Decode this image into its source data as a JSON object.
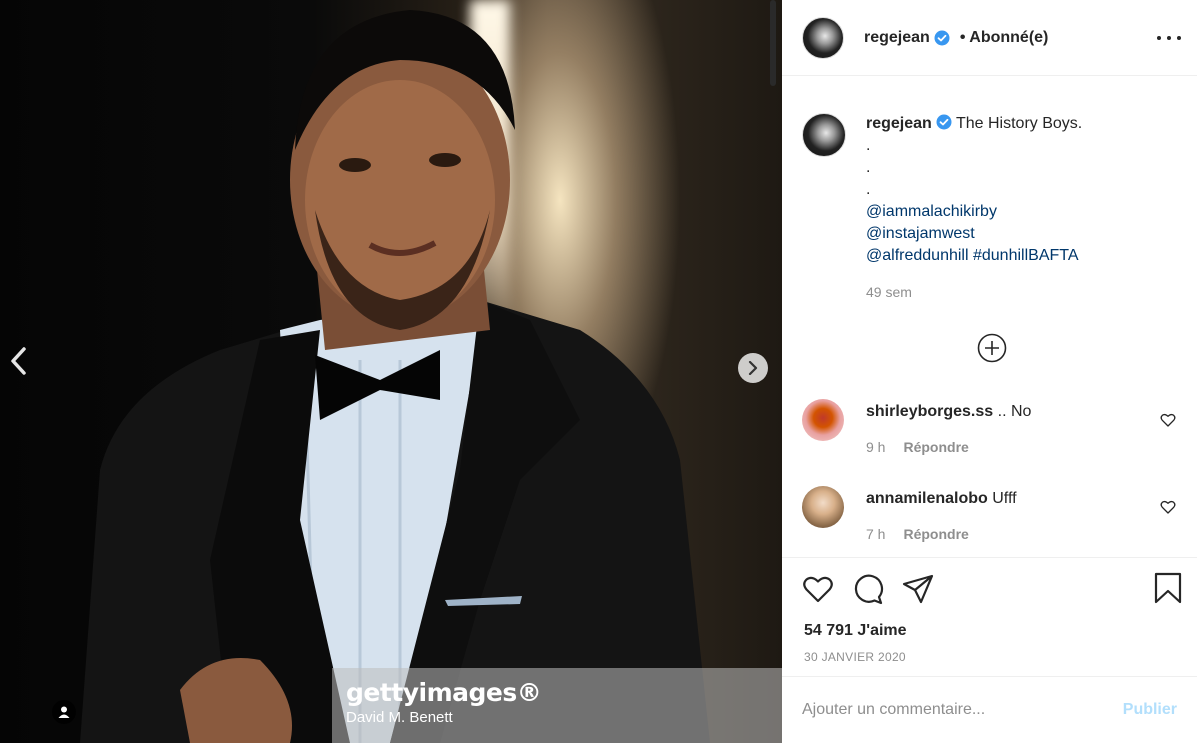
{
  "post": {
    "author": "regejean",
    "follow_status": "• Abonné(e)",
    "more_icon": "more-horizontal-icon",
    "verified_icon": "verified-badge-icon"
  },
  "media": {
    "watermark_brand": "gettyimages®",
    "watermark_credit": "David M. Benett",
    "prev_icon": "chevron-left-icon",
    "next_icon": "chevron-right-icon",
    "tag_icon": "user-tag-icon"
  },
  "caption": {
    "username": "regejean",
    "text": "The History Boys.",
    "dots": [
      ".",
      ".",
      "."
    ],
    "mentions": [
      "@iammalachikirby",
      "@instajamwest"
    ],
    "mention_last": "@alfreddunhill",
    "hashtag": "#dunhillBAFTA",
    "time": "49 sem"
  },
  "load_more_icon": "plus-circle-icon",
  "comments": [
    {
      "username": "shirleyborges.ss",
      "text": ".. No",
      "time": "9 h",
      "reply": "Répondre"
    },
    {
      "username": "annamilenalobo",
      "text": "Ufff",
      "time": "7 h",
      "reply": "Répondre"
    }
  ],
  "actions": {
    "like_icon": "heart-icon",
    "comment_icon": "comment-icon",
    "share_icon": "share-icon",
    "save_icon": "bookmark-icon"
  },
  "likes": "54 791 J'aime",
  "date": "30 JANVIER 2020",
  "add_comment": {
    "placeholder": "Ajouter un commentaire...",
    "publish": "Publier"
  },
  "colors": {
    "link": "#00376b",
    "verified": "#3897f0",
    "publish_disabled": "#b2dffc",
    "muted": "#8e8e8e"
  }
}
